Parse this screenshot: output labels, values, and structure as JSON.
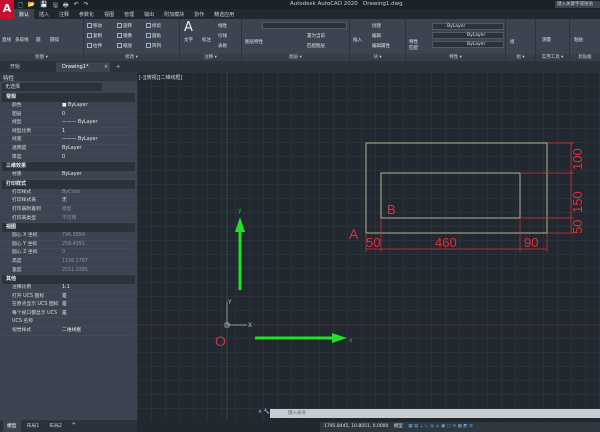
{
  "app": {
    "logo": "A",
    "title": "Autodesk AutoCAD 2020   Drawing1.dwg",
    "search_placeholder": "键入关键字或短语"
  },
  "quick_access": [
    "🗋",
    "📂",
    "💾",
    "🖫",
    "🖶",
    "↶",
    "↷"
  ],
  "ribbon_tabs": [
    "默认",
    "插入",
    "注释",
    "参数化",
    "视图",
    "管理",
    "输出",
    "附加模块",
    "协作",
    "精选应用"
  ],
  "panels": {
    "draw": {
      "title": "绘图 ▾",
      "tools": [
        "直线",
        "多段线",
        "圆",
        "圆弧"
      ]
    },
    "modify": {
      "title": "修改 ▾",
      "tools": [
        "移动",
        "旋转",
        "修剪",
        "复制",
        "镜像",
        "圆角",
        "拉伸",
        "缩放",
        "阵列"
      ]
    },
    "annotation": {
      "title": "注释 ▾",
      "tools": [
        "文字",
        "标注",
        "线性",
        "引线",
        "表格"
      ]
    },
    "layers": {
      "title": "图层 ▾",
      "tools": [
        "图层特性",
        "置为当前",
        "匹配图层"
      ]
    },
    "block": {
      "title": "块 ▾",
      "tools": [
        "插入",
        "创建",
        "编辑",
        "编辑属性"
      ]
    },
    "properties": {
      "title": "特性 ▾",
      "tools": [
        "特性匹配"
      ],
      "dropdowns": [
        "ByLayer",
        "ByLayer",
        "ByLayer"
      ]
    },
    "groups": {
      "title": "组 ▾",
      "tools": [
        "组"
      ]
    },
    "utilities": {
      "title": "实用工具 ▾",
      "tools": [
        "测量"
      ]
    },
    "clipboard": {
      "title": "剪贴板",
      "tools": [
        "粘贴"
      ]
    }
  },
  "doc_tabs": [
    "开始",
    "Drawing1*",
    "×",
    "+"
  ],
  "properties_panel": {
    "title": "特性",
    "selection": "无选择",
    "sections": [
      {
        "name": "常规",
        "rows": [
          [
            "颜色",
            "■ ByLayer"
          ],
          [
            "图层",
            "0"
          ],
          [
            "线型",
            "——— ByLayer"
          ],
          [
            "线型比例",
            "1"
          ],
          [
            "线宽",
            "——— ByLayer"
          ],
          [
            "透明度",
            "ByLayer"
          ],
          [
            "厚度",
            "0"
          ]
        ]
      },
      {
        "name": "三维效果",
        "rows": [
          [
            "材质",
            "ByLayer"
          ]
        ]
      },
      {
        "name": "打印样式",
        "rows": [
          [
            "打印样式",
            "ByColor"
          ],
          [
            "打印样式表",
            "无"
          ],
          [
            "打印表附着到",
            "模型"
          ],
          [
            "打印表类型",
            "不可用"
          ]
        ]
      },
      {
        "name": "视图",
        "rows": [
          [
            "圆心 X 坐标",
            "796.3894"
          ],
          [
            "圆心 Y 坐标",
            "258.4391"
          ],
          [
            "圆心 Z 坐标",
            "0"
          ],
          [
            "高度",
            "1156.1787"
          ],
          [
            "宽度",
            "2551.3385"
          ]
        ]
      },
      {
        "name": "其他",
        "rows": [
          [
            "注释比例",
            "1:1"
          ],
          [
            "打开 UCS 图标",
            "是"
          ],
          [
            "在原点显示 UCS 图标",
            "是"
          ],
          [
            "每个视口都显示 UCS",
            "是"
          ],
          [
            "UCS 名称",
            ""
          ],
          [
            "视觉样式",
            "二维线框"
          ]
        ]
      }
    ]
  },
  "viewport_label": "[-][俯视][二维线框]",
  "drawing": {
    "labels": {
      "A": "A",
      "B": "B",
      "O": "O",
      "x": "x",
      "y": "y",
      "ucs_x": "X",
      "ucs_y": "Y"
    },
    "dims": {
      "bottom": [
        "50",
        "460",
        "90"
      ],
      "right": [
        "100",
        "150",
        "50"
      ]
    },
    "colors": {
      "outline": "#d8d8b0",
      "dim": "#e0303a",
      "arrow": "#22e022"
    }
  },
  "command": {
    "placeholder": "键入命令",
    "buttons": "× 🔧 ▭▾"
  },
  "layout_tabs": [
    "模型",
    "布局1",
    "布局2",
    "+"
  ],
  "status": {
    "coords": "1795.8445, 10.8051, 0.0000",
    "model": "模型"
  }
}
